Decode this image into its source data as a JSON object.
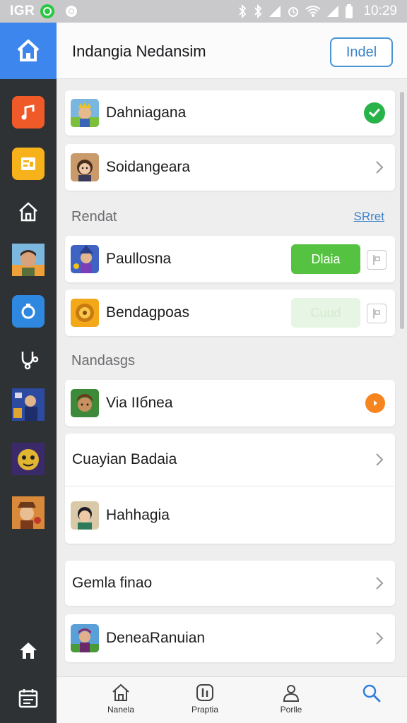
{
  "status_bar": {
    "carrier": "IGR",
    "time": "10:29"
  },
  "header": {
    "title": "Indangia Nedansim",
    "action_label": "Indel"
  },
  "list_top": [
    {
      "label": "Dahniagana",
      "trailing": "check",
      "icon": "king-avatar"
    },
    {
      "label": "Soidangeara",
      "trailing": "chevron",
      "icon": "girl-avatar"
    }
  ],
  "section_1": {
    "label": "Rendat",
    "link": "SRret"
  },
  "list_mid": [
    {
      "label": "Paullosna",
      "button": "Dlaia",
      "icon": "wizard-avatar"
    },
    {
      "label": "Bendagpoas",
      "button": "Cuud",
      "icon": "sun-emblem"
    }
  ],
  "section_2": {
    "label": "Nandasgs"
  },
  "list_bottom": [
    {
      "label": "Via IIбnea",
      "trailing": "orange-dot",
      "icon": "elf-avatar"
    },
    {
      "label": "Cuayian Badaia",
      "trailing": "chevron"
    },
    {
      "label": "Hahhagia",
      "icon": "boy-avatar"
    }
  ],
  "list_single_1": {
    "label": "Gemla finao",
    "trailing": "chevron"
  },
  "list_single_2": {
    "label": "DeneaRanuian",
    "trailing": "chevron",
    "icon": "warrior-avatar"
  },
  "bottom_nav": [
    {
      "label": "Nanela",
      "icon": "home-outline-icon"
    },
    {
      "label": "Praptia",
      "icon": "stats-icon"
    },
    {
      "label": "Porlle",
      "icon": "person-icon"
    },
    {
      "label": "",
      "icon": "search-icon",
      "active": true
    }
  ],
  "colors": {
    "accent": "#3d86ee",
    "sidebar": "#2f3234",
    "green": "#55c341",
    "orange": "#f7851f"
  }
}
